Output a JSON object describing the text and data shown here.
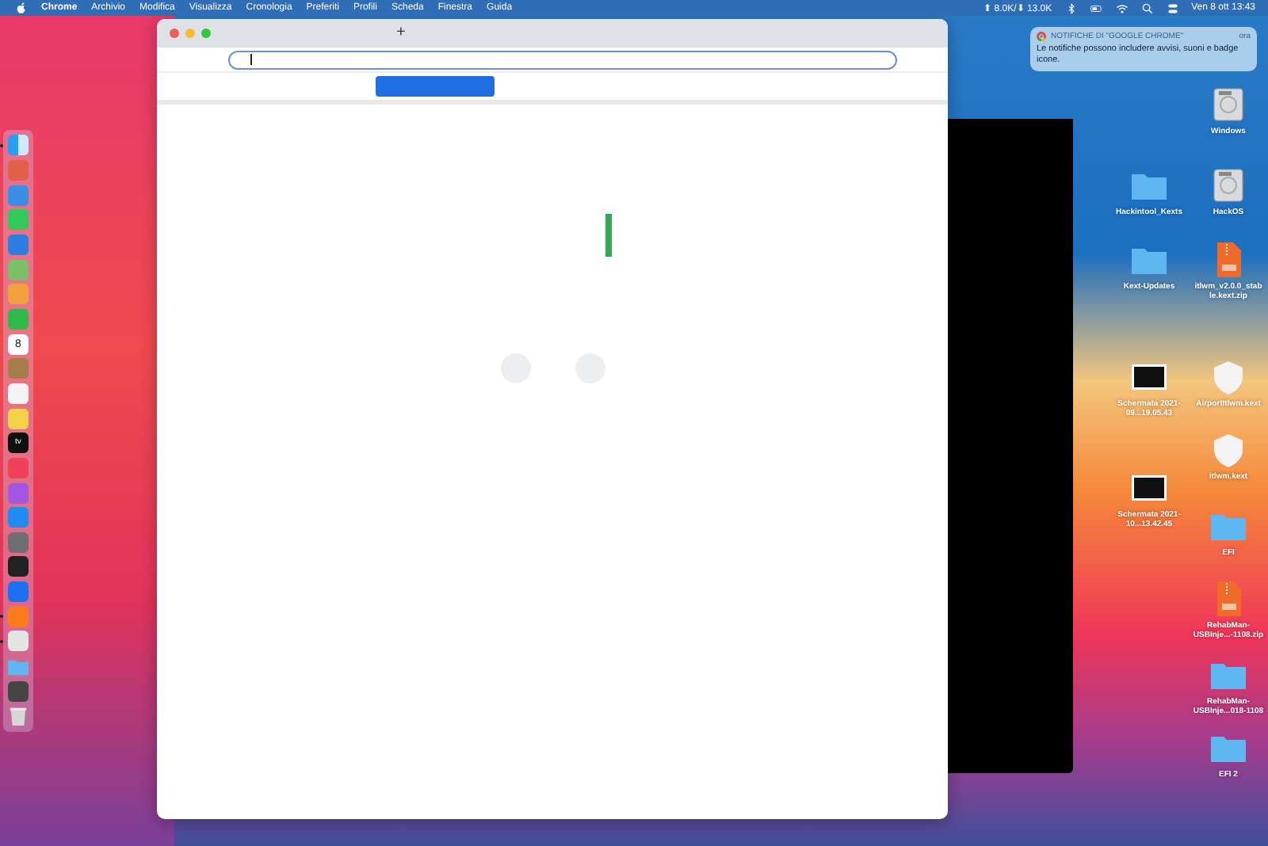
{
  "menu_bar": {
    "app": "Chrome",
    "items": [
      "Archivio",
      "Modifica",
      "Visualizza",
      "Cronologia",
      "Preferiti",
      "Profili",
      "Scheda",
      "Finestra",
      "Guida"
    ],
    "network": "⬆︎ 8.0K/⬇︎ 13.0K",
    "clock": "Ven 8 ott  13:43"
  },
  "notification": {
    "title": "NOTIFICHE DI \"GOOGLE CHROME\"",
    "time": "ora",
    "body": "Le notifiche possono includere avvisi, suoni e badge icone."
  },
  "browser": {
    "new_tab": "+"
  },
  "dock": [
    {
      "kind": "finder",
      "running": true
    },
    {
      "kind": "app",
      "color": "#e0604a",
      "running": false
    },
    {
      "kind": "app",
      "color": "#3a8ee6",
      "running": false
    },
    {
      "kind": "app",
      "color": "#34c759",
      "running": false
    },
    {
      "kind": "app",
      "color": "#2f7de1",
      "running": false
    },
    {
      "kind": "app",
      "color": "#7dc06a",
      "running": false
    },
    {
      "kind": "app",
      "color": "#f2a03d",
      "running": false
    },
    {
      "kind": "app",
      "color": "#30b84a",
      "running": false
    },
    {
      "kind": "calendar",
      "label": "8",
      "running": false
    },
    {
      "kind": "app",
      "color": "#a57c4a",
      "running": false
    },
    {
      "kind": "app",
      "color": "#f4f4f4",
      "running": false
    },
    {
      "kind": "app",
      "color": "#f6d24b",
      "running": false
    },
    {
      "kind": "tv",
      "label": "tv",
      "running": false
    },
    {
      "kind": "app",
      "color": "#f0405a",
      "running": false
    },
    {
      "kind": "app",
      "color": "#a655e0",
      "running": false
    },
    {
      "kind": "app",
      "color": "#1f8cf0",
      "running": false
    },
    {
      "kind": "app",
      "color": "#6e6e73",
      "running": false
    },
    {
      "kind": "app",
      "color": "#222222",
      "running": false
    },
    {
      "kind": "app",
      "color": "#1e6ff2",
      "running": false
    },
    {
      "kind": "app",
      "color": "#ff7a1a",
      "running": true
    },
    {
      "kind": "app",
      "color": "#e4e4e4",
      "running": true
    },
    {
      "kind": "folder",
      "running": false
    },
    {
      "kind": "app",
      "color": "#444444",
      "running": false
    },
    {
      "kind": "trash",
      "running": false
    }
  ],
  "desktop": [
    {
      "kind": "disk",
      "label": "Windows"
    },
    {
      "kind": "folder",
      "label": "Hackintool_Kexts"
    },
    {
      "kind": "disk",
      "label": "HackOS"
    },
    {
      "kind": "folder",
      "label": "Kext-Updates"
    },
    {
      "kind": "zip",
      "label": "itlwm_v2.0.0_stab le.kext.zip"
    },
    {
      "kind": "image",
      "label": "Schermata 2021-09...19.05.43"
    },
    {
      "kind": "kext",
      "label": "AirportItlwm.kext"
    },
    {
      "kind": "kext",
      "label": "itlwm.kext"
    },
    {
      "kind": "image",
      "label": "Schermata 2021-10...13.42.45"
    },
    {
      "kind": "folder",
      "label": "EFI"
    },
    {
      "kind": "zip",
      "label": "RehabMan-USBInje...-1108.zip"
    },
    {
      "kind": "folder",
      "label": "RehabMan-USBInje...018-1108"
    },
    {
      "kind": "folder",
      "label": "EFI 2"
    }
  ]
}
